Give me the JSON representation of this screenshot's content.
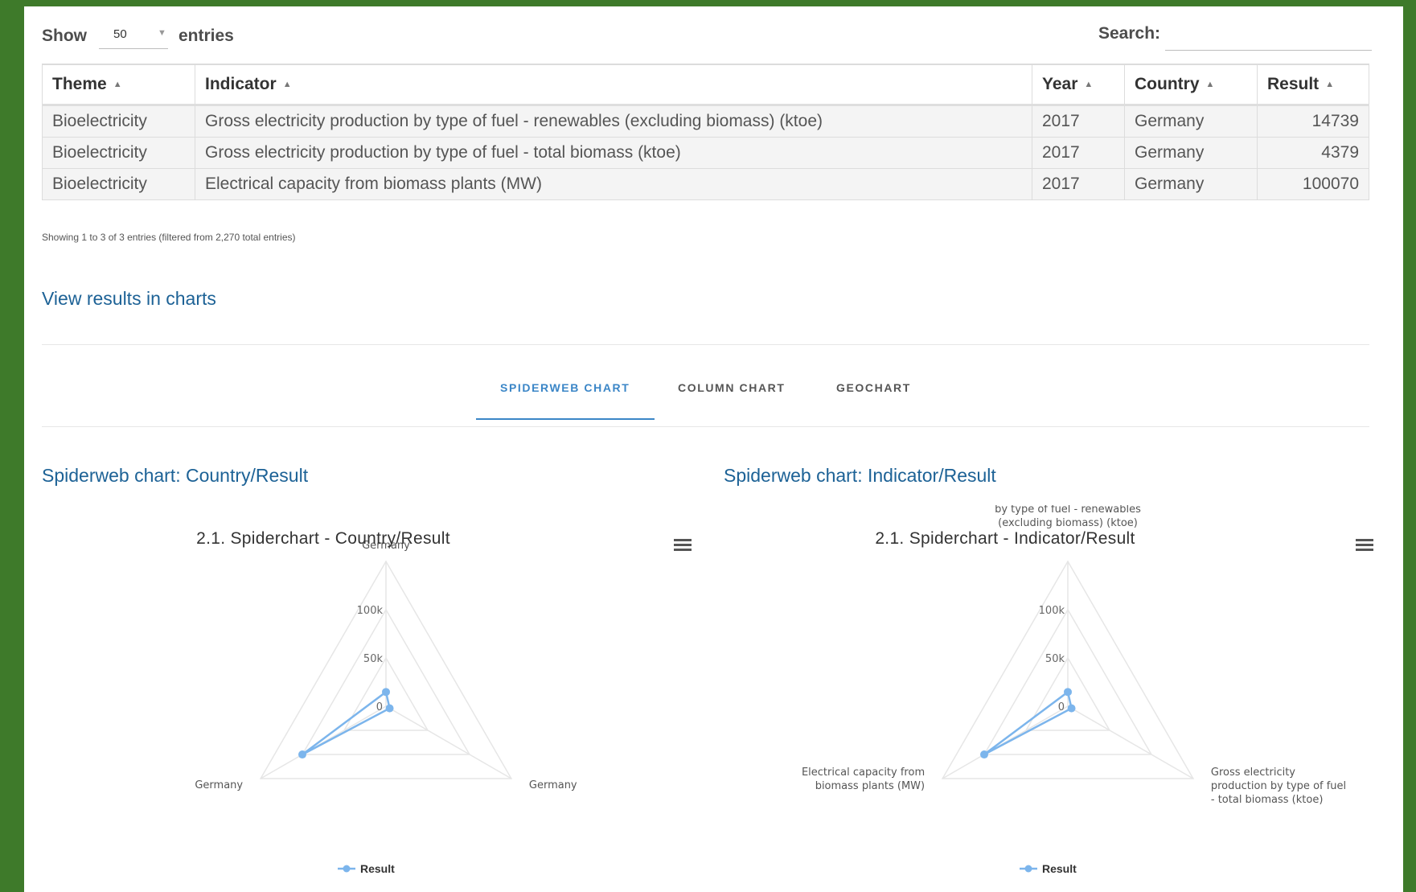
{
  "controls": {
    "show_label": "Show",
    "show_value": "50",
    "entries_label": "entries",
    "search_label": "Search:",
    "search_value": ""
  },
  "table": {
    "headers": [
      "Theme",
      "Indicator",
      "Year",
      "Country",
      "Result"
    ],
    "rows": [
      [
        "Bioelectricity",
        "Gross electricity production by type of fuel - renewables (excluding biomass) (ktoe)",
        "2017",
        "Germany",
        "14739"
      ],
      [
        "Bioelectricity",
        "Gross electricity production by type of fuel - total biomass (ktoe)",
        "2017",
        "Germany",
        "4379"
      ],
      [
        "Bioelectricity",
        "Electrical capacity from biomass plants (MW)",
        "2017",
        "Germany",
        "100070"
      ]
    ],
    "info": "Showing 1 to 3 of 3 entries (filtered from 2,270 total entries)"
  },
  "view_results_heading": "View results in charts",
  "tabs": [
    {
      "label": "SPIDERWEB CHART",
      "active": true
    },
    {
      "label": "COLUMN CHART",
      "active": false
    },
    {
      "label": "GEOCHART",
      "active": false
    }
  ],
  "colors": {
    "accent": "#3b86c7",
    "series": "#7cb5ec",
    "heading": "#1d6296"
  },
  "chart_data": [
    {
      "type": "radar",
      "heading": "Spiderweb chart: Country/Result",
      "title": "2.1. Spiderchart - Country/Result",
      "categories": [
        "Germany",
        "Germany",
        "Germany"
      ],
      "series": [
        {
          "name": "Result",
          "values": [
            14739,
            4379,
            100070
          ]
        }
      ],
      "y_ticks": [
        "0",
        "50k",
        "100k"
      ],
      "ylim": [
        0,
        150000
      ],
      "legend": "bottom"
    },
    {
      "type": "radar",
      "heading": "Spiderweb chart: Indicator/Result",
      "title": "2.1. Spiderchart - Indicator/Result",
      "categories": [
        "Gross electricity production by type of fuel - renewables (excluding biomass) (ktoe)",
        "Gross electricity production by type of fuel - total biomass (ktoe)",
        "Electrical capacity from biomass plants (MW)"
      ],
      "series": [
        {
          "name": "Result",
          "values": [
            14739,
            4379,
            100070
          ]
        }
      ],
      "y_ticks": [
        "0",
        "50k",
        "100k"
      ],
      "ylim": [
        0,
        150000
      ],
      "legend": "bottom"
    }
  ]
}
